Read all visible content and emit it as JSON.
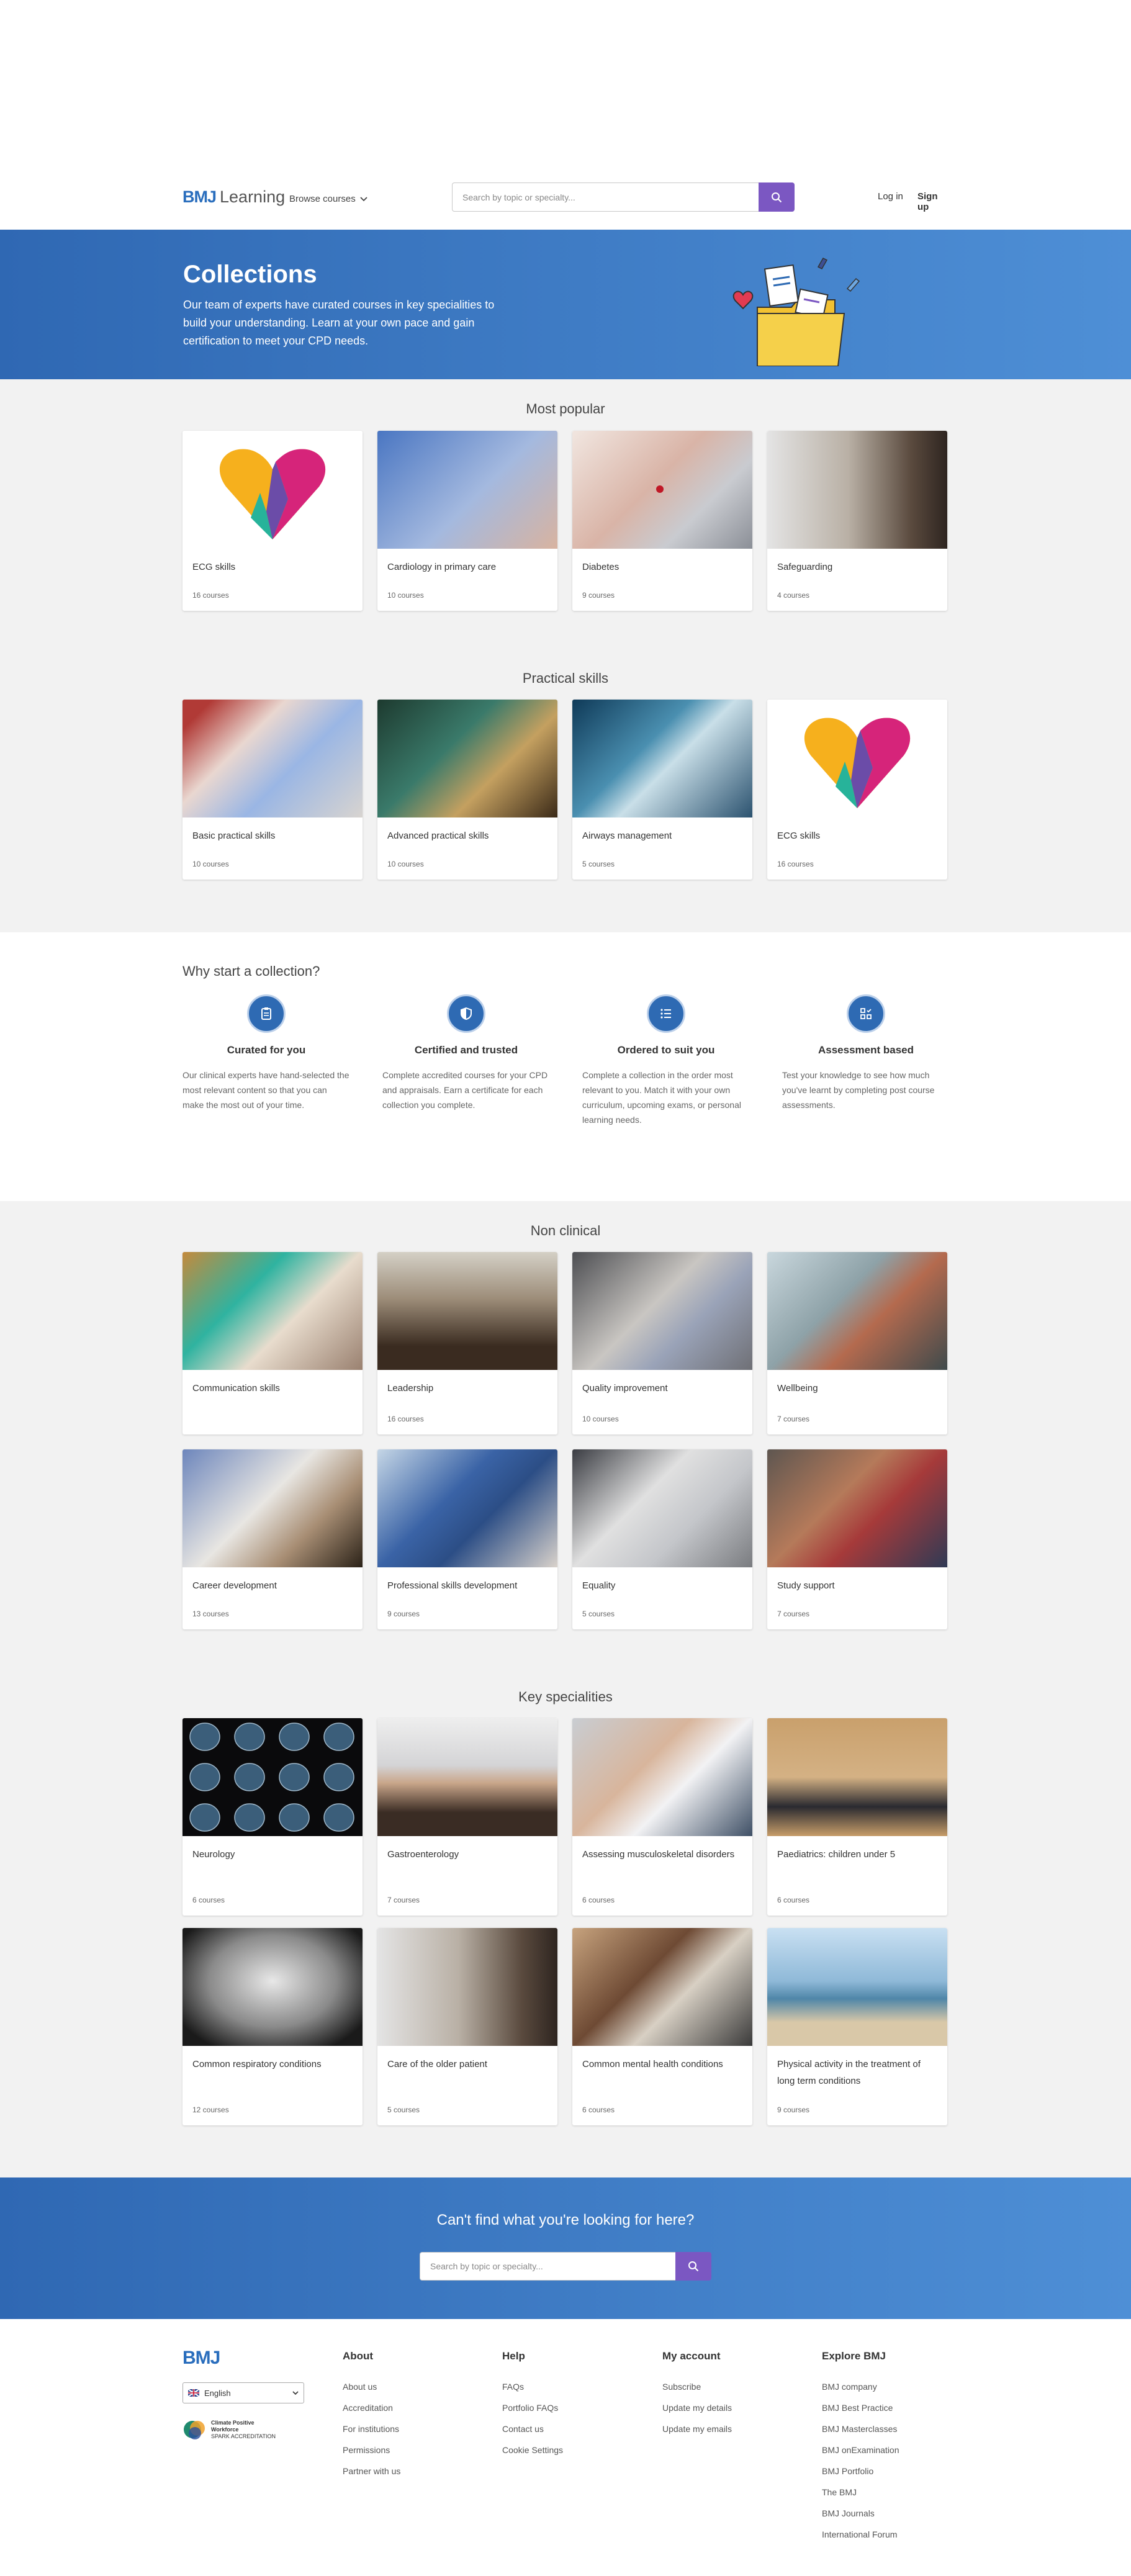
{
  "header": {
    "logo_bmj": "BMJ",
    "logo_learning": "Learning",
    "browse": "Browse courses",
    "search_placeholder": "Search by topic or specialty...",
    "login": "Log in",
    "signup": "Sign up"
  },
  "hero": {
    "title": "Collections",
    "text": "Our team of experts have curated courses in key specialities to build your understanding. Learn at your own pace and gain certification to meet your CPD needs."
  },
  "sections": {
    "most_popular": {
      "title": "Most popular",
      "cards": [
        {
          "title": "ECG skills",
          "count": "16 courses"
        },
        {
          "title": "Cardiology in primary care",
          "count": "10 courses"
        },
        {
          "title": "Diabetes",
          "count": "9 courses"
        },
        {
          "title": "Safeguarding",
          "count": "4 courses"
        }
      ]
    },
    "practical": {
      "title": "Practical skills",
      "cards": [
        {
          "title": "Basic practical skills",
          "count": "10 courses"
        },
        {
          "title": "Advanced practical skills",
          "count": "10 courses"
        },
        {
          "title": "Airways management",
          "count": "5 courses"
        },
        {
          "title": "ECG skills",
          "count": "16 courses"
        }
      ]
    },
    "non_clinical": {
      "title": "Non clinical",
      "cards": [
        {
          "title": "Communication skills",
          "count": ""
        },
        {
          "title": "Leadership",
          "count": "16 courses"
        },
        {
          "title": "Quality improvement",
          "count": "10 courses"
        },
        {
          "title": "Wellbeing",
          "count": "7 courses"
        },
        {
          "title": "Career development",
          "count": "13 courses"
        },
        {
          "title": "Professional skills development",
          "count": "9 courses"
        },
        {
          "title": "Equality",
          "count": "5 courses"
        },
        {
          "title": "Study support",
          "count": "7 courses"
        }
      ]
    },
    "key_specialities": {
      "title": "Key specialities",
      "cards": [
        {
          "title": "Neurology",
          "count": "6 courses"
        },
        {
          "title": "Gastroenterology",
          "count": "7 courses"
        },
        {
          "title": "Assessing musculoskeletal disorders",
          "count": "6 courses"
        },
        {
          "title": "Paediatrics: children under 5",
          "count": "6 courses"
        },
        {
          "title": "Common respiratory conditions",
          "count": "12 courses"
        },
        {
          "title": "Care of the older patient",
          "count": "5 courses"
        },
        {
          "title": "Common mental health conditions",
          "count": "6 courses"
        },
        {
          "title": "Physical activity in the treatment of long term conditions",
          "count": "9 courses"
        }
      ]
    }
  },
  "why": {
    "title": "Why start a collection?",
    "features": [
      {
        "title": "Curated for you",
        "text": "Our clinical experts have hand-selected the most relevant content so that you can make the most out of your time.",
        "icon": "clipboard-icon"
      },
      {
        "title": "Certified and trusted",
        "text": "Complete accredited courses for your CPD and appraisals. Earn a certificate for each collection you complete.",
        "icon": "shield-icon"
      },
      {
        "title": "Ordered to suit you",
        "text": "Complete a collection in the order most relevant to you. Match it with your own curriculum, upcoming exams, or personal learning needs.",
        "icon": "list-icon"
      },
      {
        "title": "Assessment based",
        "text": "Test your knowledge to see how much you've learnt by completing post course assessments.",
        "icon": "assessment-icon"
      }
    ]
  },
  "cta": {
    "title": "Can't find what you're looking for here?",
    "search_placeholder": "Search by topic or specialty..."
  },
  "footer": {
    "logo": "BMJ",
    "language": "English",
    "badge_line1": "Climate Positive",
    "badge_line2": "Workforce",
    "badge_line3": "SPARK ACCREDITATION",
    "about": {
      "title": "About",
      "links": [
        "About us",
        "Accreditation",
        "For institutions",
        "Permissions",
        "Partner with us"
      ]
    },
    "help": {
      "title": "Help",
      "links": [
        "FAQs",
        "Portfolio FAQs",
        "Contact us",
        "Cookie Settings"
      ]
    },
    "account": {
      "title": "My account",
      "links": [
        "Subscribe",
        "Update my details",
        "Update my emails"
      ]
    },
    "explore": {
      "title": "Explore BMJ",
      "links": [
        "BMJ company",
        "BMJ Best Practice",
        "BMJ Masterclasses",
        "BMJ onExamination",
        "BMJ Portfolio",
        "The BMJ",
        "BMJ Journals",
        "International Forum"
      ]
    }
  },
  "colors": {
    "primary": "#2e6ab3",
    "accent": "#7b57c2",
    "section_bg": "#f2f2f2"
  }
}
